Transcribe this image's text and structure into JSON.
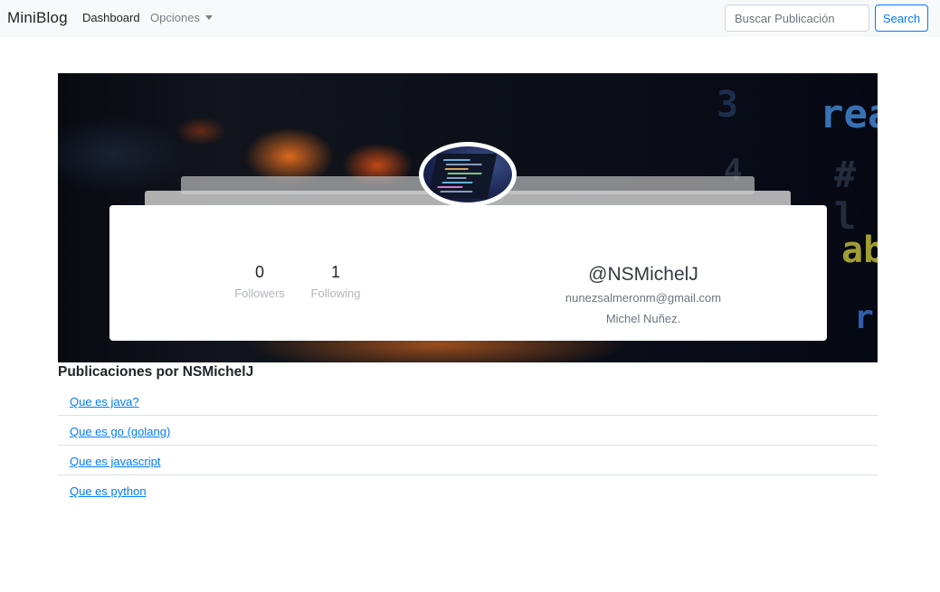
{
  "navbar": {
    "brand": "MiniBlog",
    "dashboard": "Dashboard",
    "options": "Opciones",
    "search_placeholder": "Buscar Publicación",
    "search_button": "Search"
  },
  "profile": {
    "followers_count": "0",
    "followers_label": "Followers",
    "following_count": "1",
    "following_label": "Following",
    "handle": "@NSMichelJ",
    "email": "nunezsalmeronm@gmail.com",
    "name": "Michel Nuñez."
  },
  "posts": {
    "title": "Publicaciones por NSMichelJ",
    "items": [
      "Que es java?",
      "Que es go (golang)",
      "Que es javascript",
      "Que es python"
    ]
  },
  "colors": {
    "navbar_bg": "#f8f9fa",
    "link": "#007bff",
    "muted": "#6c757d"
  }
}
